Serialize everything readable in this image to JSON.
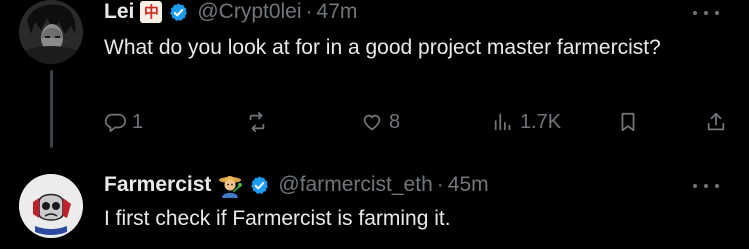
{
  "posts": [
    {
      "name": "Lei",
      "badge_glyph": "中",
      "handle": "@Crypt0lei",
      "time": "47m",
      "text": "What do you look at for in a good project master farmercist?",
      "counts": {
        "replies": "1",
        "likes": "8",
        "views": "1.7K"
      }
    },
    {
      "name": "Farmercist",
      "handle": "@farmercist_eth",
      "time": "45m",
      "text": "I first check if Farmercist is farming it."
    }
  ],
  "separator": "·",
  "colors": {
    "verified": "#1d9bf0",
    "muted": "#71767b",
    "text": "#e7e9ea",
    "background": "#000000"
  },
  "icons": [
    "reply-icon",
    "retweet-icon",
    "like-icon",
    "views-icon",
    "bookmark-icon",
    "share-icon",
    "verified-icon",
    "more-icon"
  ]
}
